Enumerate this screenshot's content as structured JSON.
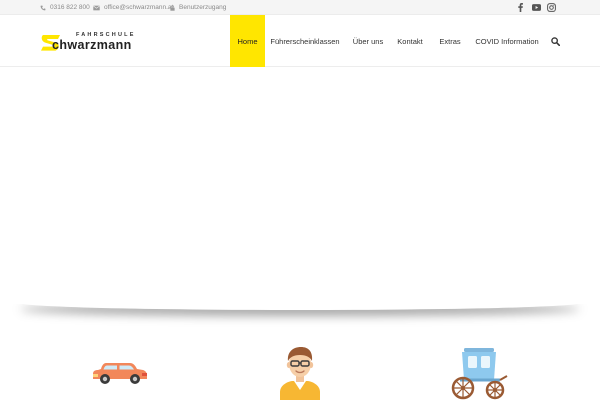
{
  "topbar": {
    "phone": "0316 822 800",
    "email": "office@schwarzmann.at",
    "login": "Benutzerzugang"
  },
  "logo": {
    "top_word": "FAHRSCHULE",
    "main_word": "chwarzmann",
    "mark_color": "#ffe600"
  },
  "nav": {
    "items": [
      {
        "label": "Home",
        "active": true
      },
      {
        "label": "Führerscheinklassen"
      },
      {
        "label": "Über uns"
      },
      {
        "label": "Kontakt"
      },
      {
        "label": "Extras"
      },
      {
        "label": "COVID Information"
      }
    ]
  },
  "icons": {
    "phone": "phone-icon",
    "email": "envelope-icon",
    "login": "lock-icon",
    "facebook": "facebook-icon",
    "youtube": "youtube-icon",
    "instagram": "instagram-icon",
    "search": "search-icon",
    "car": "car-icon",
    "instructor": "instructor-icon",
    "carriage": "carriage-icon"
  },
  "colors": {
    "accent": "#ffe600",
    "car": "#f2875a",
    "carriage": "#8ec9ee"
  }
}
